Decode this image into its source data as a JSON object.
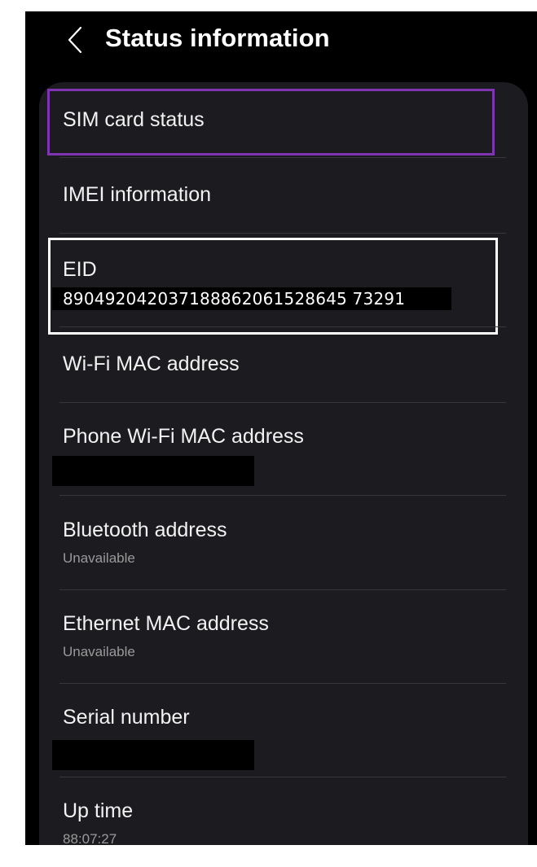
{
  "header": {
    "back_label": "Back",
    "title": "Status information"
  },
  "items": [
    {
      "label": "SIM card status"
    },
    {
      "label": "IMEI information"
    },
    {
      "label": "EID",
      "value": "890492042037188862061528645 73291"
    },
    {
      "label": "Wi-Fi MAC address"
    },
    {
      "label": "Phone Wi-Fi MAC address"
    },
    {
      "label": "Bluetooth address",
      "value": "Unavailable"
    },
    {
      "label": "Ethernet MAC address",
      "value": "Unavailable"
    },
    {
      "label": "Serial number"
    },
    {
      "label": "Up time",
      "value": "88:07:27"
    }
  ],
  "colors": {
    "background": "#000000",
    "card": "#1c1b1f",
    "focus_purple": "#7f35b2",
    "focus_white": "#ffffff",
    "subtext": "#9a9a9a"
  },
  "icons": {
    "back": "chevron-left-icon"
  }
}
